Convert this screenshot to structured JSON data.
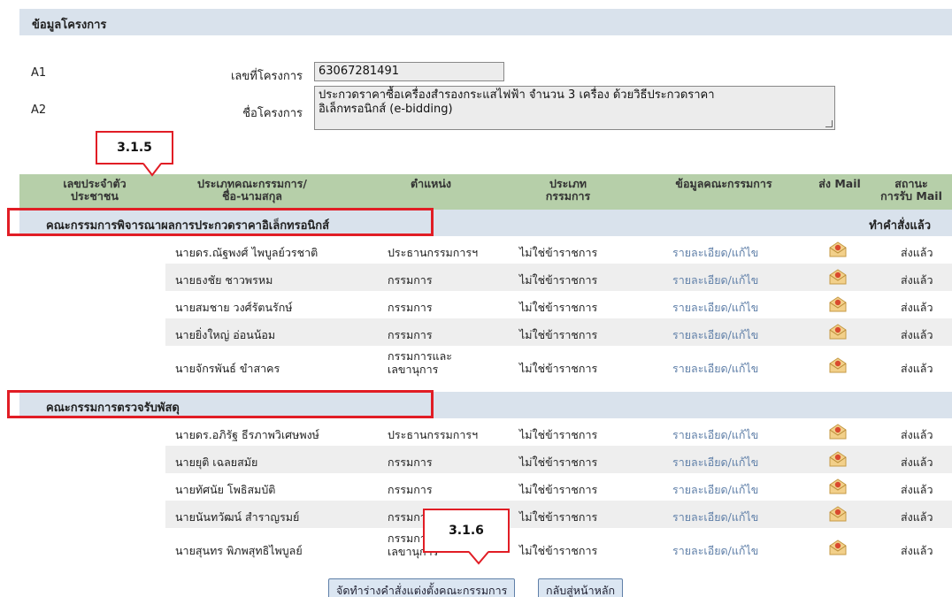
{
  "section": {
    "title": "ข้อมูลโครงการ"
  },
  "fields": {
    "a1_code": "A1",
    "a1_label": "เลขที่โครงการ",
    "a1_value": "63067281491",
    "a2_code": "A2",
    "a2_label": "ชื่อโครงการ",
    "a2_value_line1": "ประกวดราคาซื้อเครื่องสำรองกระแสไฟฟ้า จำนวน 3 เครื่อง ด้วยวิธีประกวดราคา",
    "a2_value_line2": "อิเล็กทรอนิกส์ (e-bidding)"
  },
  "table": {
    "headers": {
      "id_l1": "เลขประจำตัว",
      "id_l2": "ประชาชน",
      "name_l1": "ประเภทคณะกรรมการ/",
      "name_l2": "ชื่อ-นามสกุล",
      "position": "ตำแหน่ง",
      "type_l1": "ประเภท",
      "type_l2": "กรรมการ",
      "info": "ข้อมูลคณะกรรมการ",
      "send_mail": "ส่ง Mail",
      "status_l1": "สถานะ",
      "status_l2": "การรับ Mail"
    },
    "groups": [
      {
        "title": "คณะกรรมการพิจารณาผลการประกวดราคาอิเล็กทรอนิกส์",
        "status": "ทำคำสั่งแล้ว",
        "rows": [
          {
            "name": "นายดร.ณัฐพงศ์ ไพบูลย์วรชาติ",
            "position": "ประธานกรรมการฯ",
            "type": "ไม่ใช่ข้าราชการ",
            "link": "รายละเอียด/แก้ไข",
            "mail_status": "ส่งแล้ว"
          },
          {
            "name": "นายธงชัย ชาวพรหม",
            "position": "กรรมการ",
            "type": "ไม่ใช่ข้าราชการ",
            "link": "รายละเอียด/แก้ไข",
            "mail_status": "ส่งแล้ว"
          },
          {
            "name": "นายสมชาย วงศ์รัตนรักษ์",
            "position": "กรรมการ",
            "type": "ไม่ใช่ข้าราชการ",
            "link": "รายละเอียด/แก้ไข",
            "mail_status": "ส่งแล้ว"
          },
          {
            "name": "นายยิ่งใหญ่ อ่อนน้อม",
            "position": "กรรมการ",
            "type": "ไม่ใช่ข้าราชการ",
            "link": "รายละเอียด/แก้ไข",
            "mail_status": "ส่งแล้ว"
          },
          {
            "name": "นายจักรพันธ์ ขำสาคร",
            "position_l1": "กรรมการและ",
            "position_l2": "เลขานุการ",
            "type": "ไม่ใช่ข้าราชการ",
            "link": "รายละเอียด/แก้ไข",
            "mail_status": "ส่งแล้ว"
          }
        ]
      },
      {
        "title": "คณะกรรมการตรวจรับพัสดุ",
        "rows": [
          {
            "name": "นายดร.อภิรัฐ ธีรภาพวิเศษพงษ์",
            "position": "ประธานกรรมการฯ",
            "type": "ไม่ใช่ข้าราชการ",
            "link": "รายละเอียด/แก้ไข",
            "mail_status": "ส่งแล้ว"
          },
          {
            "name": "นายยุติ เฉลยสมัย",
            "position": "กรรมการ",
            "type": "ไม่ใช่ข้าราชการ",
            "link": "รายละเอียด/แก้ไข",
            "mail_status": "ส่งแล้ว"
          },
          {
            "name": "นายทัศนัย โพธิสมบัติ",
            "position": "กรรมการ",
            "type": "ไม่ใช่ข้าราชการ",
            "link": "รายละเอียด/แก้ไข",
            "mail_status": "ส่งแล้ว"
          },
          {
            "name": "นายนันทวัฒน์ สำราญรมย์",
            "position": "กรรมการ",
            "type": "ไม่ใช่ข้าราชการ",
            "link": "รายละเอียด/แก้ไข",
            "mail_status": "ส่งแล้ว"
          },
          {
            "name": "นายสุนทร พิภพสุทธิไพบูลย์",
            "position_l1": "กรรมการและ",
            "position_l2": "เลขานุการ",
            "type": "ไม่ใช่ข้าราชการ",
            "link": "รายละเอียด/แก้ไข",
            "mail_status": "ส่งแล้ว"
          }
        ]
      }
    ]
  },
  "callouts": {
    "c1": "3.1.5",
    "c2": "3.1.6"
  },
  "buttons": {
    "create_order": "จัดทำร่างคำสั่งแต่งตั้งคณะกรรมการ",
    "back_home": "กลับสู่หน้าหลัก"
  },
  "icons": {
    "mail": "envelope-icon"
  },
  "colors": {
    "accent_red": "#e11d25",
    "link": "#5f7fa8",
    "header_green": "#b6cfa9",
    "section_blue": "#d9e2ec"
  }
}
